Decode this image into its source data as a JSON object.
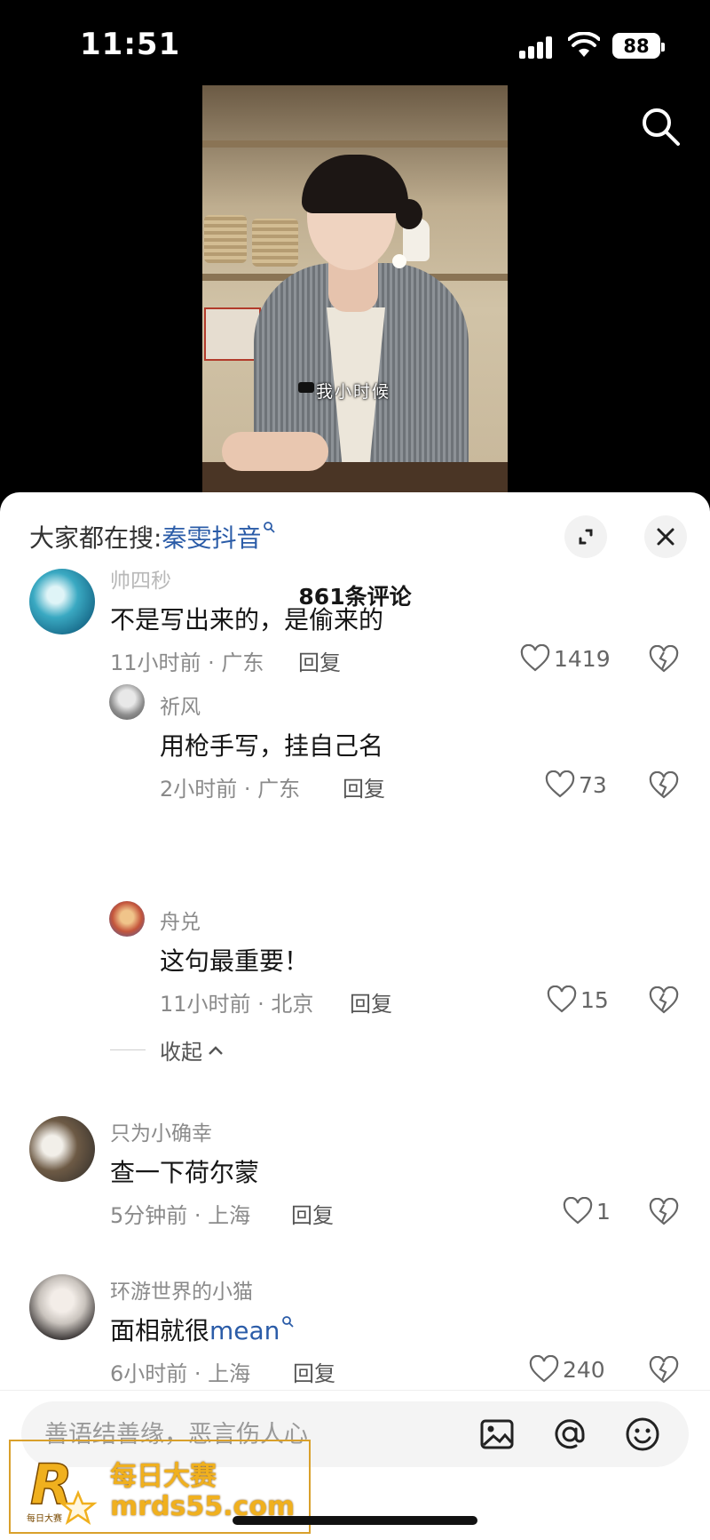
{
  "status_bar": {
    "time": "11:51",
    "battery": "88"
  },
  "video": {
    "subtitle": "我小时候"
  },
  "hot_search": {
    "prefix": "大家都在搜:",
    "keyword": "秦雯抖音"
  },
  "comments_title": "861条评论",
  "comments": [
    {
      "user": "帅四秒",
      "text": "不是写出来的，是偷来的",
      "time_location": "11小时前 · 广东",
      "reply_label": "回复",
      "likes": "1419"
    },
    {
      "user": "祈风",
      "text": "用枪手写，挂自己名",
      "time_location": "2小时前 · 广东",
      "reply_label": "回复",
      "likes": "73"
    },
    {
      "user": "舟兑",
      "text": "这句最重要！",
      "time_location": "11小时前 · 北京",
      "reply_label": "回复",
      "likes": "15"
    },
    {
      "user": "只为小确幸",
      "text": "查一下荷尔蒙",
      "time_location": "5分钟前 · 上海",
      "reply_label": "回复",
      "likes": "1"
    },
    {
      "user": "环游世界的小猫",
      "text_prefix": "面相就很",
      "text_keyword": "mean",
      "time_location": "6小时前 · 上海",
      "reply_label": "回复",
      "likes": "240"
    }
  ],
  "collapse_label": "收起",
  "input": {
    "placeholder": "善语结善缘，恶言伤人心"
  },
  "watermark": {
    "line1": "每日大赛",
    "line2": "mrds55.com",
    "logo_text": "R",
    "logo_small": "每日大赛"
  },
  "icons": [
    "search-icon",
    "expand-icon",
    "close-icon",
    "heart-icon",
    "broken-heart-icon",
    "image-icon",
    "at-icon",
    "emoji-icon"
  ]
}
